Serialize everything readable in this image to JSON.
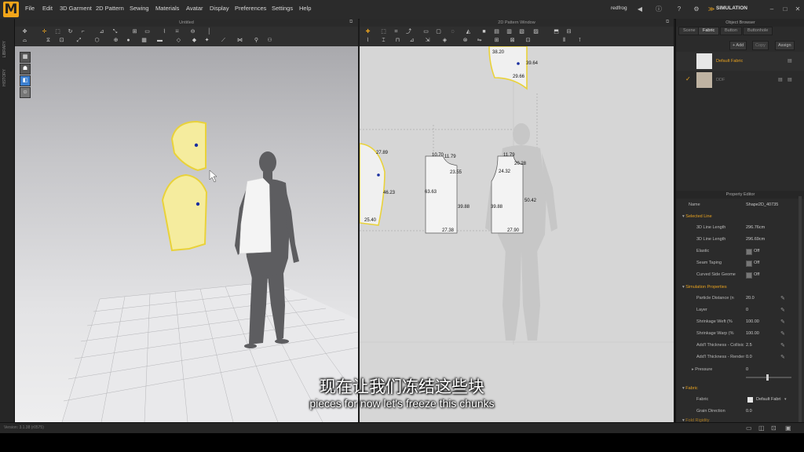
{
  "app": {
    "logo": "M",
    "menu": [
      "File",
      "Edit",
      "3D Garment",
      "2D Pattern",
      "Sewing",
      "Materials",
      "Avatar",
      "Display",
      "Preferences",
      "Settings",
      "Help"
    ],
    "user": "redfrog",
    "mode": "SIMULATION",
    "version": "Version: 3.1.38 (r0575)"
  },
  "left_strip": [
    "LIBRARY",
    "HISTORY"
  ],
  "panel3d": {
    "title": "Untitled"
  },
  "panel2d": {
    "title": "2D Pattern Window",
    "dimensions": [
      {
        "id": "d1",
        "text": "38.20"
      },
      {
        "id": "d2",
        "text": "39.64"
      },
      {
        "id": "d3",
        "text": "29.66"
      },
      {
        "id": "d4",
        "text": "27.89"
      },
      {
        "id": "d5",
        "text": "46.23"
      },
      {
        "id": "d6",
        "text": "25.40"
      },
      {
        "id": "d7",
        "text": "10.70"
      },
      {
        "id": "d8",
        "text": "11.79"
      },
      {
        "id": "d9",
        "text": "23.55"
      },
      {
        "id": "d10",
        "text": "63.63"
      },
      {
        "id": "d11",
        "text": "39.88"
      },
      {
        "id": "d12",
        "text": "27.38"
      },
      {
        "id": "d13",
        "text": "11.79"
      },
      {
        "id": "d14",
        "text": "20.28"
      },
      {
        "id": "d15",
        "text": "24.32"
      },
      {
        "id": "d16",
        "text": "39.88"
      },
      {
        "id": "d17",
        "text": "50.42"
      },
      {
        "id": "d18",
        "text": "27.90"
      }
    ]
  },
  "object_browser": {
    "title": "Object Browser",
    "tabs": [
      "Scene",
      "Fabric",
      "Button",
      "Buttonhole"
    ],
    "active_tab": "Fabric",
    "buttons": [
      "+ Add",
      "Copy",
      "Assign"
    ],
    "fabrics": [
      {
        "name": "Default Fabric",
        "swatch": "#e6e6e6"
      },
      {
        "name": "DDF",
        "swatch": "#bfb3a2"
      }
    ]
  },
  "property_editor": {
    "title": "Property Editor",
    "name_label": "Name",
    "name_value": "Shape2D_40735",
    "selected_line": {
      "header": "Selected Line",
      "rows": [
        {
          "label": "3D Line Length",
          "value": "296.76cm"
        },
        {
          "label": "3D Line Length",
          "value": "296.69cm"
        },
        {
          "label": "Elastic",
          "value": "Off",
          "check": true
        },
        {
          "label": "Seam Taping",
          "value": "Off",
          "check": true
        },
        {
          "label": "Curved Side Geome",
          "value": "Off",
          "check": true
        }
      ]
    },
    "simulation": {
      "header": "Simulation Properties",
      "rows": [
        {
          "label": "Particle Distance (n",
          "value": "20.0"
        },
        {
          "label": "Layer",
          "value": "0"
        },
        {
          "label": "Shrinkage Weft (%",
          "value": "100.00"
        },
        {
          "label": "Shrinkage Warp (%",
          "value": "100.00"
        },
        {
          "label": "Add'l Thickness - Collisic",
          "value": "2.5"
        },
        {
          "label": "Add'l Thickness - Render",
          "value": "0.0"
        }
      ],
      "pressure_label": "Pressure",
      "pressure_value": "0"
    },
    "fabric": {
      "header": "Fabric",
      "rows": [
        {
          "label": "Fabric",
          "value": "Default Fabri"
        },
        {
          "label": "Grain Direction",
          "value": "0.0"
        }
      ],
      "next_header": "Fold Rigidity"
    }
  },
  "subtitles": {
    "cn": "现在让我们冻结这些块",
    "en": "pieces for now let's freeze this chunks"
  },
  "colors": {
    "accent": "#e8a21f",
    "pattern_yellow": "#f5ec9e",
    "pattern_outline": "#e9d23a",
    "point": "#1a2fa0"
  }
}
